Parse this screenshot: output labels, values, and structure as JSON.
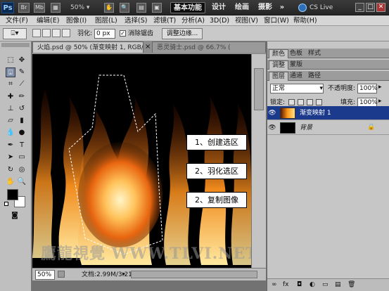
{
  "appbar": {
    "logo": "Ps",
    "icon_br": "Br",
    "icon_mb": "Mb",
    "zoom": "50%",
    "workspaces": [
      "基本功能",
      "设计",
      "绘画",
      "摄影"
    ],
    "more": "»",
    "cslive": "CS Live",
    "window_controls": [
      "_",
      "□",
      "✕"
    ]
  },
  "menubar": {
    "items": [
      "文件(F)",
      "编辑(E)",
      "图像(I)",
      "图层(L)",
      "选择(S)",
      "滤镜(T)",
      "分析(A)",
      "3D(D)",
      "视图(V)",
      "窗口(W)",
      "帮助(H)"
    ]
  },
  "options": {
    "feather_label": "羽化:",
    "feather_value": "0 px",
    "antialias_label": "消除锯齿",
    "antialias_checked": true,
    "refine_edge": "调整边缘..."
  },
  "document": {
    "tabs": [
      "火焰.psd @ 50% (渐变映射 1, RGB/8) *",
      "恶灵骑士.psd @ 66.7% ("
    ],
    "tab_close": "×",
    "callouts": [
      "1、创建选区",
      "2、羽化选区",
      "2、复制图像"
    ],
    "watermark": "鷹龍視覺 WWW.TLVI.NET",
    "status_zoom": "50%",
    "status_doc": "文档:2.99M/3.21M"
  },
  "panels": {
    "top_tabs": [
      "颜色",
      "色板",
      "样式"
    ],
    "mid_tabs": [
      "调整",
      "蒙版"
    ],
    "layer_tabs": [
      "图层",
      "通道",
      "路径"
    ],
    "blend_mode": "正常",
    "opacity_label": "不透明度:",
    "opacity_value": "100%",
    "lock_label": "锁定:",
    "fill_label": "填充:",
    "fill_value": "100%",
    "layers": [
      {
        "name": "渐变映射 1",
        "selected": true
      },
      {
        "name": "背景",
        "selected": false
      }
    ],
    "bottom_icons": [
      "∞",
      "fx",
      "◘",
      "◐",
      "▭",
      "▤",
      "🗑"
    ]
  },
  "colors": {
    "selected_layer": "#1c3a8c",
    "foreground": "#000000",
    "background": "#ffffff"
  }
}
